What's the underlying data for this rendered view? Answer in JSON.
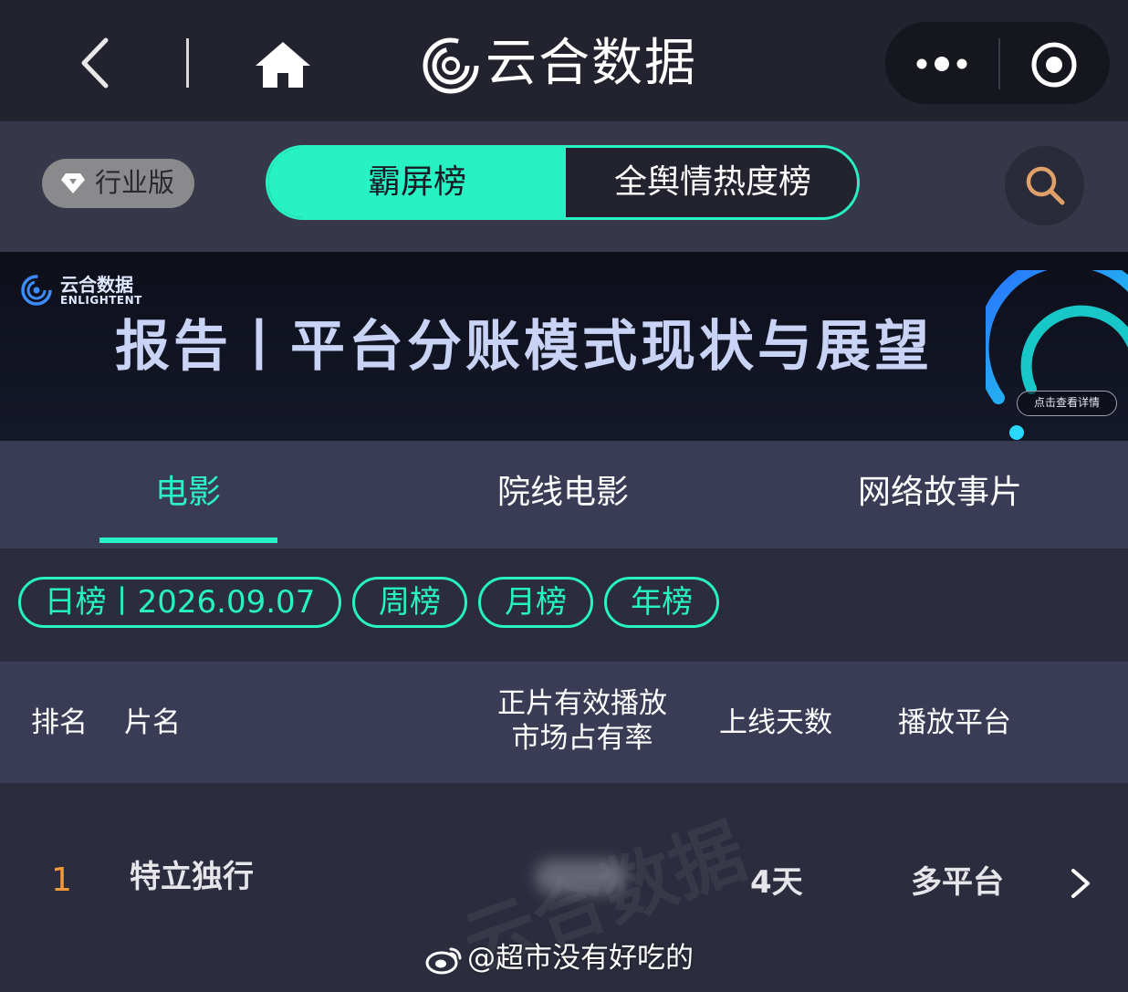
{
  "header": {
    "app_title": "云合数据",
    "icons": [
      "chevron-left-icon",
      "home-icon",
      "logo-icon",
      "more-icon",
      "target-icon"
    ]
  },
  "subheader": {
    "industry_label": "行业版",
    "toggle": {
      "active": "霸屏榜",
      "inactive": "全舆情热度榜"
    }
  },
  "banner": {
    "brand": "云合数据",
    "brand_en": "ENLIGHTENT",
    "title": "报告丨平台分账模式现状与展望",
    "cta": "点击查看详情"
  },
  "tabs": {
    "items": [
      "电影",
      "院线电影",
      "网络故事片"
    ],
    "active_index": 0
  },
  "filters": {
    "day": "日榜丨2026.09.07",
    "week": "周榜",
    "month": "月榜",
    "year": "年榜"
  },
  "table": {
    "headers": {
      "rank": "排名",
      "name": "片名",
      "share_line1": "正片有效播放",
      "share_line2": "市场占有率",
      "days": "上线天数",
      "platform": "播放平台"
    },
    "rows": [
      {
        "rank": "1",
        "name": "特立独行",
        "days": "4天",
        "platform": "多平台"
      }
    ]
  },
  "watermark": {
    "handle": "@超市没有好吃的"
  },
  "colors": {
    "accent": "#27f2c4",
    "rank_orange": "#f29a3a",
    "topbar_bg": "#22232f",
    "panel_bg": "#3a3b54"
  }
}
